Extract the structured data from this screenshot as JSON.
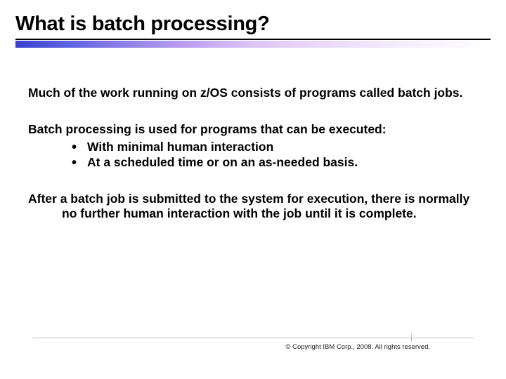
{
  "title": "What is batch processing?",
  "para1_part1": "Much of the work running on z/OS consists of programs called ",
  "para1_part2": "batch jobs.",
  "para2_lead": "Batch processing is used for programs that can be executed:",
  "bullets": {
    "b0": "With minimal human interaction",
    "b1": "At a scheduled time or on an as-needed basis."
  },
  "para3": "After a batch job is submitted to the system for execution, there is normally no further human interaction with the job until it is complete.",
  "copyright": "© Copyright IBM Corp., 2008. All rights reserved."
}
